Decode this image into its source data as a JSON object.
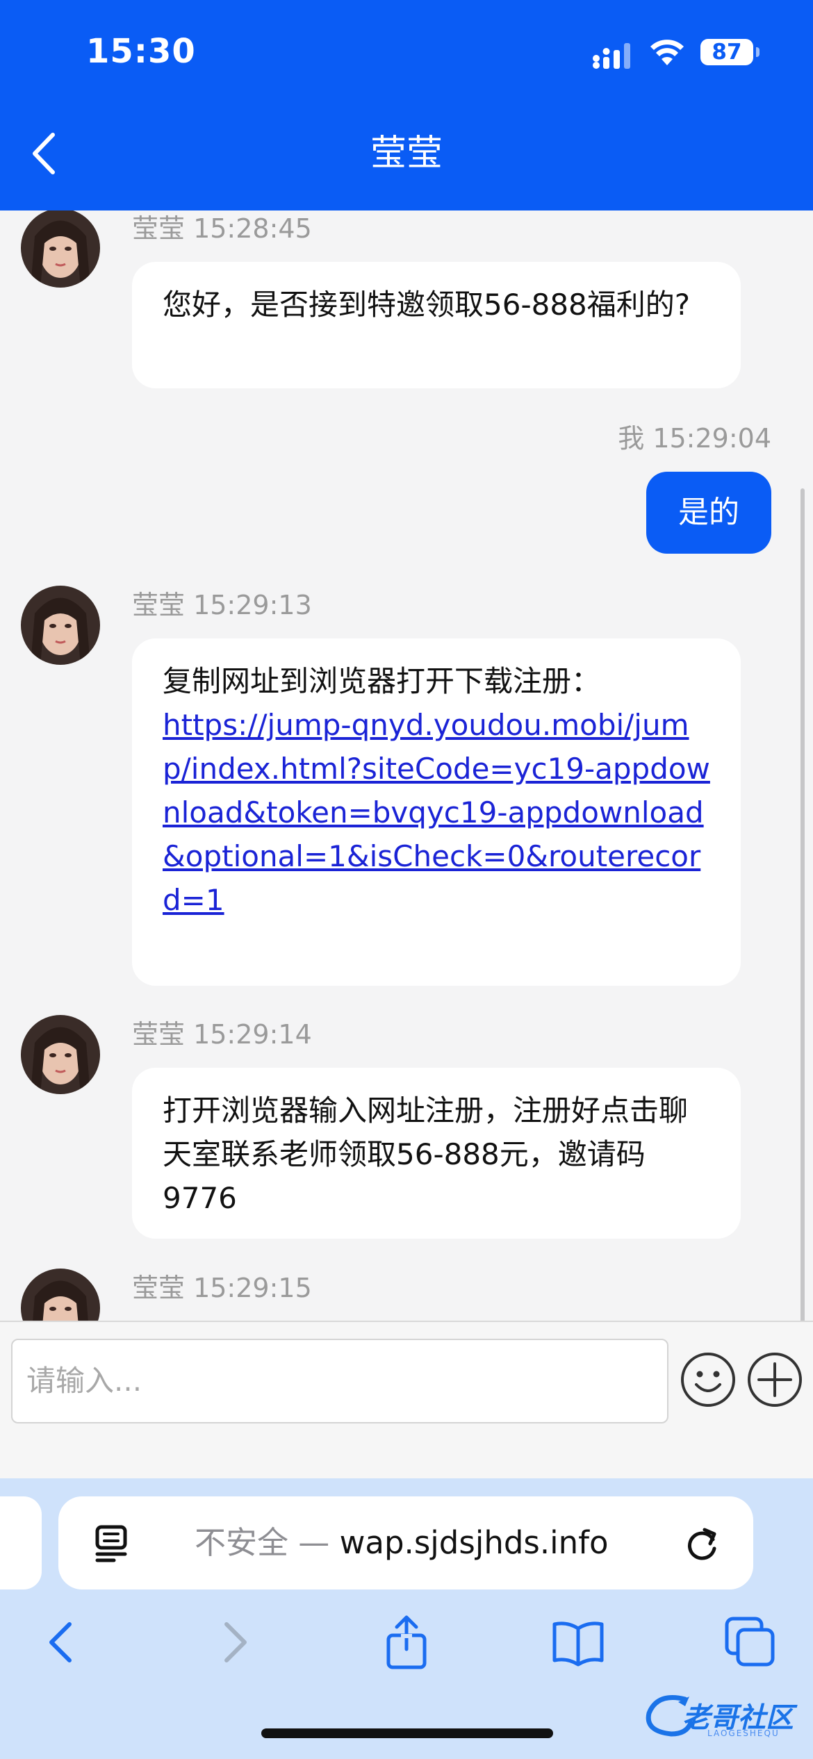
{
  "status_bar": {
    "time": "15:30",
    "battery": "87"
  },
  "header": {
    "title": "莹莹"
  },
  "messages": [
    {
      "sender": "莹莹",
      "time": "莹莹 15:28:45",
      "text": "您好，是否接到特邀领取56-888福利的?"
    },
    {
      "sender": "我",
      "time": "我 15:29:04",
      "text": "是的"
    },
    {
      "sender": "莹莹",
      "time": "莹莹 15:29:13",
      "text": "复制网址到浏览器打开下载注册：",
      "link": "https://jump-qnyd.youdou.mobi/jump/index.html?siteCode=yc19-appdownload&token=bvqyc19-appdownload&optional=1&isCheck=0&routerecord=1"
    },
    {
      "sender": "莹莹",
      "time": "莹莹 15:29:14",
      "text": "打开浏览器输入网址注册，注册好点击聊天室联系老师领取56-888元，邀请码9776"
    },
    {
      "sender": "莹莹",
      "time": "莹莹 15:29:15",
      "text": ""
    }
  ],
  "input": {
    "placeholder": "请输入..."
  },
  "browser": {
    "insecure_label": "不安全 — ",
    "domain": "wap.sjdsjhds.info"
  },
  "watermark": {
    "text": "老哥社区",
    "sub": "LAOGESHEQU"
  },
  "colors": {
    "accent": "#0a5cf5",
    "link": "#1a23d6",
    "browser_bar": "#cfe2fb"
  }
}
